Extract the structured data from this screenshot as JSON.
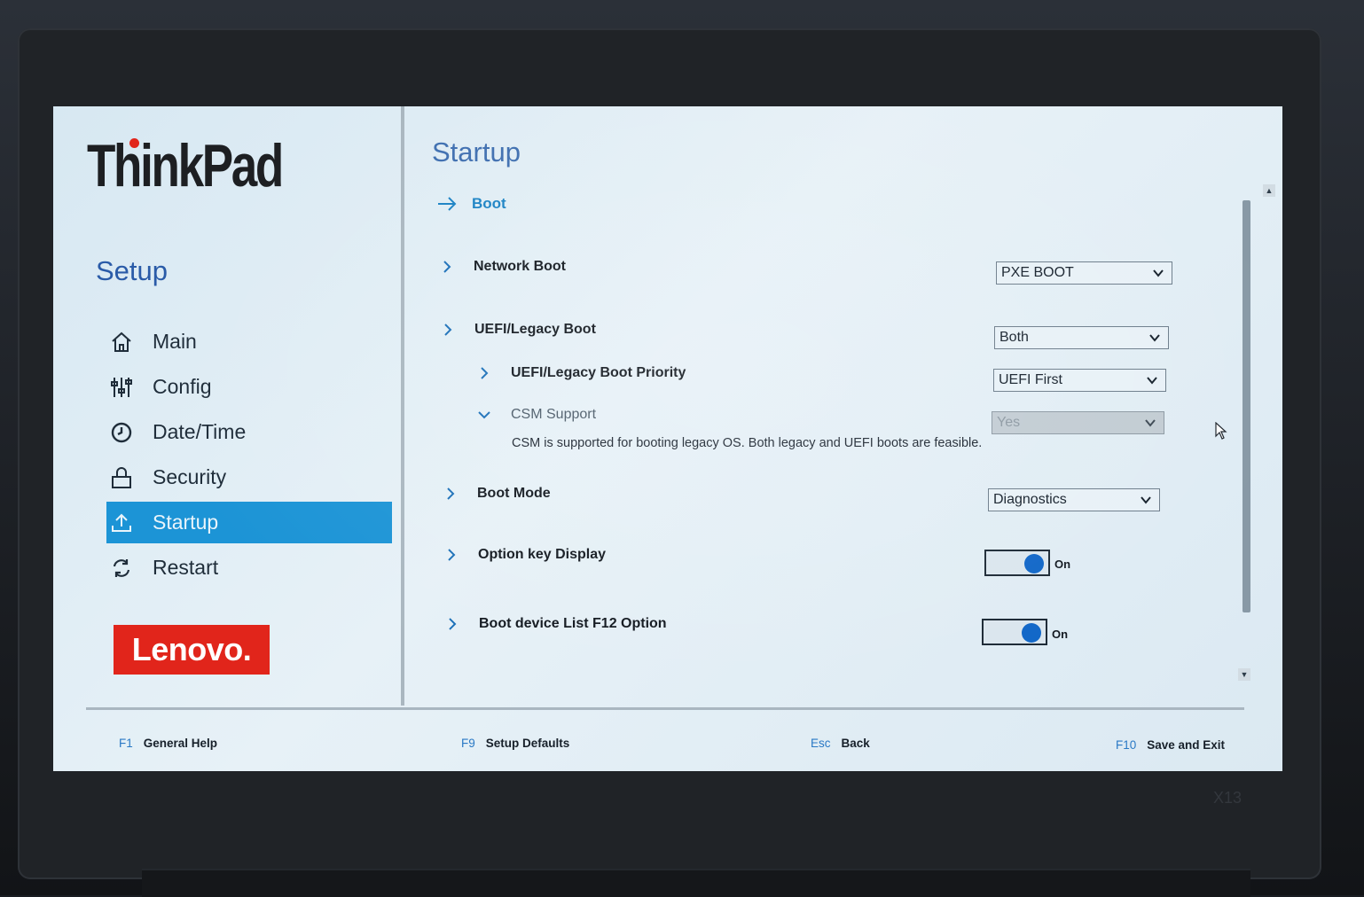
{
  "sidebar": {
    "brand": "ThinkPad",
    "setup_title": "Setup",
    "items": [
      {
        "label": "Main",
        "icon": "home-icon"
      },
      {
        "label": "Config",
        "icon": "sliders-icon"
      },
      {
        "label": "Date/Time",
        "icon": "clock-icon"
      },
      {
        "label": "Security",
        "icon": "lock-icon"
      },
      {
        "label": "Startup",
        "icon": "upload-icon",
        "active": true
      },
      {
        "label": "Restart",
        "icon": "restart-icon"
      }
    ],
    "vendor_logo": "Lenovo."
  },
  "main": {
    "title": "Startup",
    "breadcrumb": "Boot",
    "rows": {
      "network_boot": {
        "label": "Network Boot",
        "value": "PXE BOOT"
      },
      "uefi_legacy_boot": {
        "label": "UEFI/Legacy Boot",
        "value": "Both"
      },
      "uefi_legacy_priority": {
        "label": "UEFI/Legacy Boot Priority",
        "value": "UEFI First"
      },
      "csm_support": {
        "label": "CSM Support",
        "value": "Yes",
        "description": "CSM is supported for booting legacy OS. Both legacy and UEFI boots are feasible."
      },
      "boot_mode": {
        "label": "Boot Mode",
        "value": "Diagnostics"
      },
      "option_key_display": {
        "label": "Option key Display",
        "state": "On"
      },
      "boot_device_list": {
        "label": "Boot device List F12 Option",
        "state": "On"
      }
    }
  },
  "footer": {
    "help": {
      "key": "F1",
      "label": "General Help"
    },
    "defaults": {
      "key": "F9",
      "label": "Setup Defaults"
    },
    "back": {
      "key": "Esc",
      "label": "Back"
    },
    "save": {
      "key": "F10",
      "label": "Save and Exit"
    }
  },
  "bezel": {
    "model": "X13"
  },
  "colors": {
    "accent": "#1c94d6",
    "title": "#3f6fb0",
    "brand_red": "#e1251b",
    "toggle_knob": "#1167c8"
  }
}
